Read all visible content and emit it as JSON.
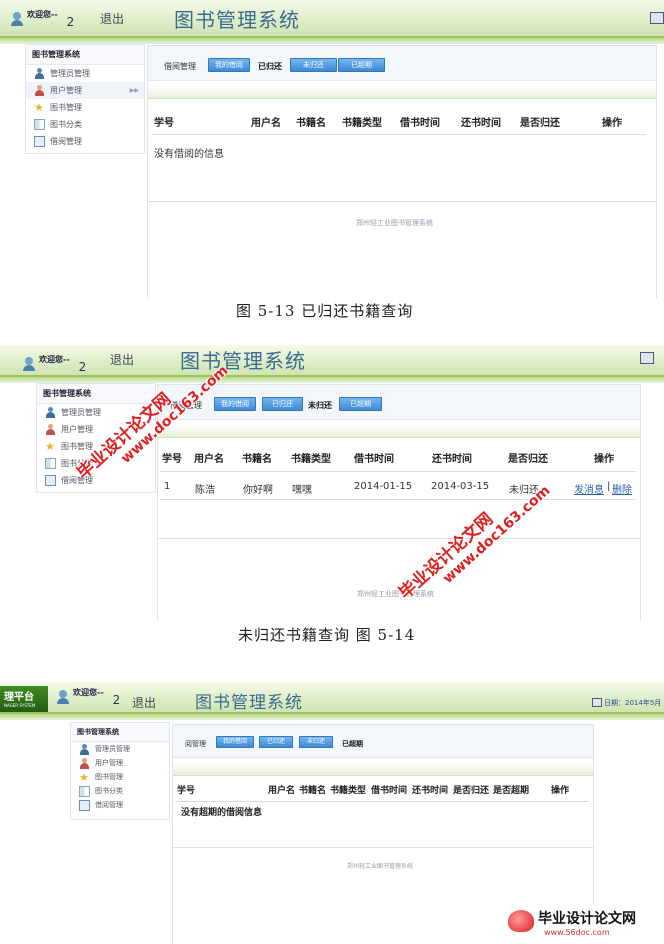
{
  "app": {
    "welcome": "欢迎您--",
    "user_count": "2",
    "logout": "退出",
    "system_name": "图书管理系统",
    "sidebar_title": "图书管理系统",
    "sidebar_items": [
      "管理员管理",
      "用户管理",
      "图书管理",
      "图书分类",
      "借阅管理"
    ],
    "toolbar_label": "借阅管理",
    "btn_my_borrow": "我的借阅",
    "btn_returned": "已归还",
    "btn_unreturned": "未归还",
    "btn_overdue": "已超期",
    "footer": "郑州轻工业图书管理系统"
  },
  "fig13": {
    "columns": [
      "学号",
      "用户名",
      "书籍名",
      "书籍类型",
      "借书时间",
      "还书时间",
      "是否归还",
      "操作"
    ],
    "empty_message": "没有借阅的信息",
    "caption": "图 5-13 已归还书籍查询"
  },
  "fig14": {
    "columns": [
      "学号",
      "用户名",
      "书籍名",
      "书籍类型",
      "借书时间",
      "还书时间",
      "是否归还",
      "操作"
    ],
    "row": {
      "id": "1",
      "user": "陈浩",
      "book": "你好啊",
      "type": "嘿嘿",
      "borrow": "2014-01-15",
      "return": "2014-03-15",
      "returned": "未归还",
      "action_msg": "发消息",
      "action_sep": "|",
      "action_del": "删除"
    },
    "caption": "未归还书籍查询 图 5-14"
  },
  "fig15": {
    "logo": "理平台",
    "logo_sub": "NAGER SYSTEM",
    "date_label": "日期：2014年5月",
    "toolbar_label": "阅管理",
    "columns": [
      "学号",
      "用户名",
      "书籍名",
      "书籍类型",
      "借书时间",
      "还书时间",
      "是否归还",
      "是否超期",
      "操作"
    ],
    "empty_message": "没有超期的借阅信息"
  },
  "watermarks": {
    "cn": "毕业设计论文网",
    "url": "www.doc163.com",
    "brand": "毕业设计论文网",
    "brand_url": "www.56doc.com"
  },
  "colors": {
    "accent_blue": "#3f8ad6",
    "header_green": "#9cc45a",
    "watermark_red": "#e02020"
  }
}
